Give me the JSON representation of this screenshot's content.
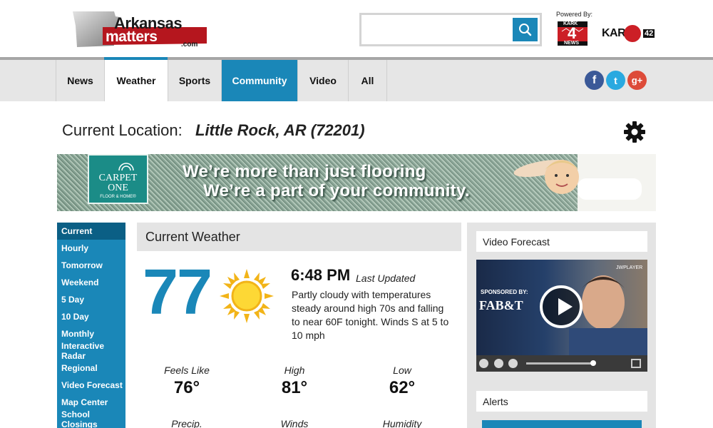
{
  "header": {
    "logo": {
      "line1": "Arkansas",
      "line2": "matters",
      "line3": ".com"
    },
    "search": {
      "placeholder": "",
      "value": ""
    },
    "powered_by": "Powered By:",
    "partners": [
      {
        "icon": "kark-4-news-logo",
        "text_top": "KARK",
        "text_num": "4",
        "text_bottom": "NEWS"
      },
      {
        "icon": "karz-42-logo",
        "text": "KARZ",
        "num": "42"
      }
    ]
  },
  "nav": {
    "tabs": [
      {
        "label": "News"
      },
      {
        "label": "Weather"
      },
      {
        "label": "Sports"
      },
      {
        "label": "Community"
      },
      {
        "label": "Video"
      },
      {
        "label": "All"
      }
    ],
    "active": "Weather",
    "social": [
      {
        "icon": "facebook-icon",
        "glyph": "f",
        "color": "#3b5998"
      },
      {
        "icon": "twitter-icon",
        "glyph": "t",
        "color": "#2aa9e0"
      },
      {
        "icon": "google-plus-icon",
        "glyph": "g+",
        "color": "#dd4b39"
      }
    ]
  },
  "location": {
    "label": "Current Location:",
    "value": "Little Rock, AR (72201)"
  },
  "ad": {
    "logo_line1": "CARPET",
    "logo_line2": "ONE",
    "logo_tag": "FLOOR & HOME®",
    "line1": "We’re more than just flooring",
    "line2": "We’re a part of your community."
  },
  "sidebar": {
    "items": [
      {
        "label": "Current"
      },
      {
        "label": "Hourly"
      },
      {
        "label": "Tomorrow"
      },
      {
        "label": "Weekend"
      },
      {
        "label": "5 Day"
      },
      {
        "label": "10 Day"
      },
      {
        "label": "Monthly"
      },
      {
        "label": "Interactive Radar"
      },
      {
        "label": "Regional"
      },
      {
        "label": "Video Forecast"
      },
      {
        "label": "Map Center"
      },
      {
        "label": "School Closings"
      }
    ],
    "active": "Current"
  },
  "current": {
    "title": "Current Weather",
    "temp": "77",
    "condition_icon": "sun-icon",
    "time": "6:48 PM",
    "last_updated": "Last Updated",
    "description": "Partly cloudy with temperatures steady around high 70s and falling to near 60F tonight. Winds S at 5 to 10 mph",
    "metrics": [
      {
        "label": "Feels Like",
        "value": "76°"
      },
      {
        "label": "High",
        "value": "81°"
      },
      {
        "label": "Low",
        "value": "62°"
      },
      {
        "label": "Precip.",
        "value": ""
      },
      {
        "label": "Winds",
        "value": ""
      },
      {
        "label": "Humidity",
        "value": ""
      }
    ]
  },
  "right": {
    "video_title": "Video Forecast",
    "video": {
      "sponsored": "SPONSORED BY:",
      "sponsor": "FAB&T",
      "player": "JWPLAYER"
    },
    "alerts_title": "Alerts"
  },
  "colors": {
    "accent": "#1a87b8",
    "accent_dark": "#0b5f85",
    "panel_bg": "#e4e4e4",
    "nav_bg": "#e6e6e6"
  }
}
